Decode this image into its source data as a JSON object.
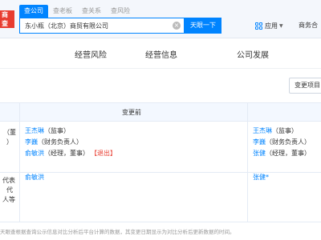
{
  "header": {
    "logo_text": [
      "商",
      "查"
    ],
    "search_tabs": [
      "查公司",
      "查老板",
      "查关系",
      "查风险"
    ],
    "search_value": "东小瓶（北京）商贸有限公司",
    "search_button": "天眼一下",
    "app_label": "应用",
    "biz_link": "商务合"
  },
  "category_tabs": [
    "经营风险",
    "经营信息",
    "公司发展"
  ],
  "toolbar": {
    "change_item_label": "变更项目"
  },
  "table": {
    "header_before": "变更前",
    "rows": [
      {
        "left_lines": [
          "（董",
          "）"
        ],
        "before": [
          {
            "name": "王杰琳",
            "role": "（监事）",
            "exit": ""
          },
          {
            "name": "李巍",
            "role": "（财务负责人）",
            "exit": ""
          },
          {
            "name": "俞敏洪",
            "role": "（经理，董事）",
            "exit": "【退出】"
          }
        ],
        "after": [
          {
            "name": "王杰琳",
            "role": "（监事）"
          },
          {
            "name": "李巍",
            "role": "（财务负责人）"
          },
          {
            "name": "张健",
            "role": "（经理，董事）"
          }
        ]
      },
      {
        "left_lines": [
          "代表",
          "代",
          "人等"
        ],
        "before_text": "俞敏洪",
        "after_text": "张健*"
      }
    ]
  },
  "footer": "天眼查根据查询公示信息对比分析后平台计算的数据，其变更日期显示为对比分析后更新数据的时间。"
}
